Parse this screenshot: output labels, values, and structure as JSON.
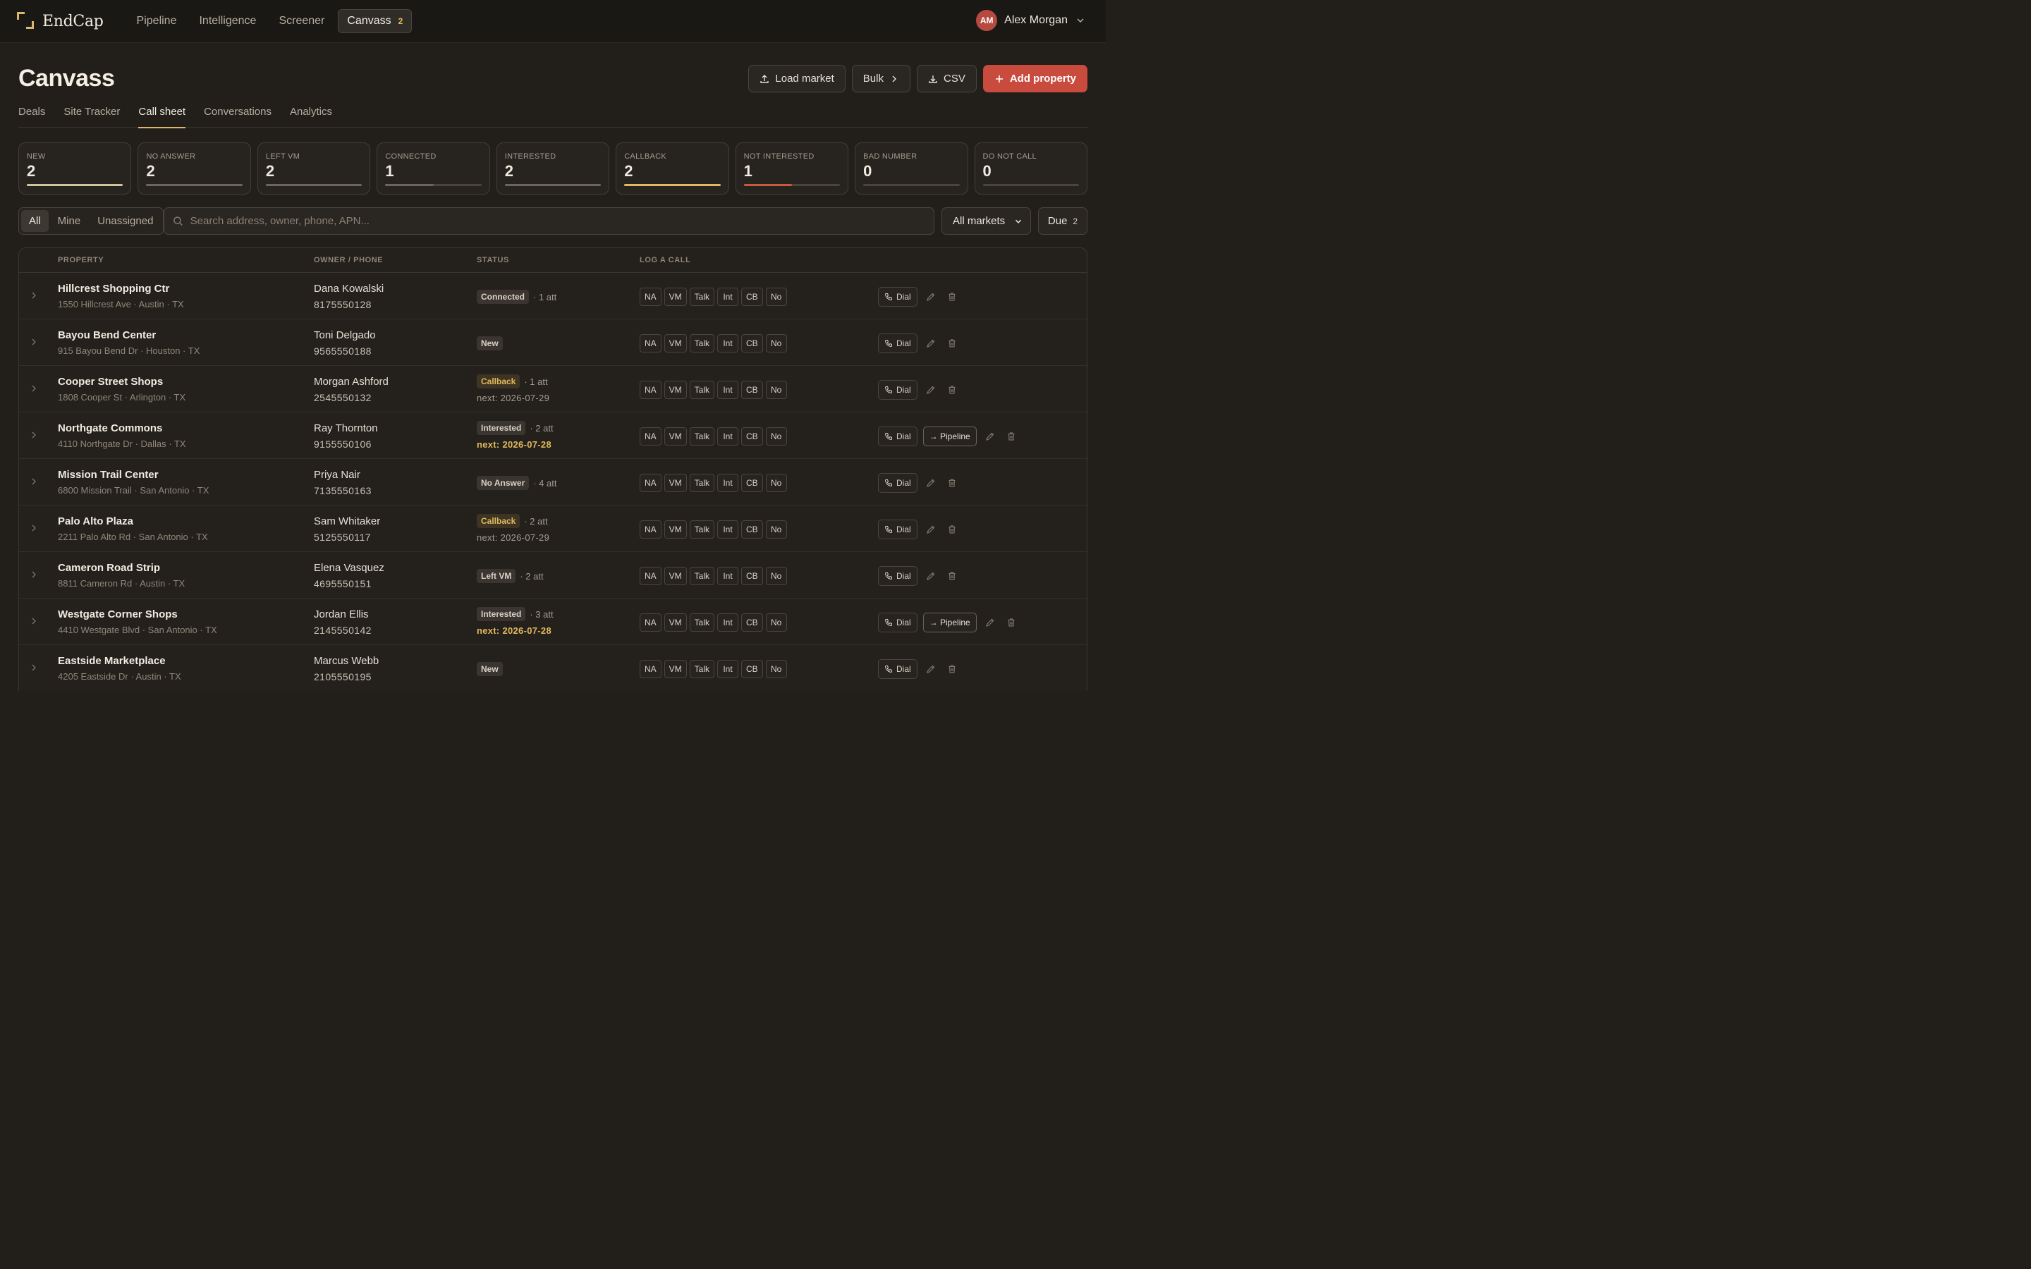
{
  "app": {
    "name": "EndCap"
  },
  "nav": {
    "links": [
      {
        "label": "Pipeline"
      },
      {
        "label": "Intelligence"
      },
      {
        "label": "Screener"
      },
      {
        "label": "Canvass",
        "badge": "2"
      }
    ]
  },
  "user": {
    "initials": "AM",
    "name": "Alex Morgan"
  },
  "page": {
    "title": "Canvass",
    "actions": {
      "load_market": "Load market",
      "bulk": "Bulk",
      "csv": "CSV",
      "add_property": "Add property"
    },
    "tabs": [
      "Deals",
      "Site Tracker",
      "Call sheet",
      "Conversations",
      "Analytics"
    ],
    "active_tab": "Call sheet"
  },
  "stats": [
    {
      "label": "NEW",
      "value": "2",
      "fill": 1.0,
      "color": "#cfc39e"
    },
    {
      "label": "NO ANSWER",
      "value": "2",
      "fill": 1.0,
      "color": "#6b655c"
    },
    {
      "label": "LEFT VM",
      "value": "2",
      "fill": 1.0,
      "color": "#6b655c"
    },
    {
      "label": "CONNECTED",
      "value": "1",
      "fill": 0.5,
      "color": "#6b655c"
    },
    {
      "label": "INTERESTED",
      "value": "2",
      "fill": 1.0,
      "color": "#6b655c"
    },
    {
      "label": "CALLBACK",
      "value": "2",
      "fill": 1.0,
      "color": "#e0b95e"
    },
    {
      "label": "NOT INTERESTED",
      "value": "1",
      "fill": 0.5,
      "color": "#c9583f"
    },
    {
      "label": "BAD NUMBER",
      "value": "0",
      "fill": 0,
      "color": "#6b655c"
    },
    {
      "label": "DO NOT CALL",
      "value": "0",
      "fill": 0,
      "color": "#6b655c"
    }
  ],
  "filters": {
    "scope": [
      "All",
      "Mine",
      "Unassigned"
    ],
    "active_scope": "All",
    "search_placeholder": "Search address, owner, phone, APN...",
    "market": "All markets",
    "due_label": "Due",
    "due_count": "2"
  },
  "table": {
    "headers": {
      "property": "PROPERTY",
      "owner": "OWNER / PHONE",
      "status": "STATUS",
      "log": "LOG A CALL"
    },
    "log_buttons": [
      "NA",
      "VM",
      "Talk",
      "Int",
      "CB",
      "No"
    ],
    "dial_label": "Dial",
    "pipeline_label": "→ Pipeline",
    "rows": [
      {
        "name": "Hillcrest Shopping Ctr",
        "address": "1550 Hillcrest Ave · Austin · TX",
        "owner": "Dana Kowalski",
        "phone": "8175550128",
        "status": "Connected",
        "attempts": "· 1 att",
        "next": "",
        "next_hot": false,
        "pipeline": false
      },
      {
        "name": "Bayou Bend Center",
        "address": "915 Bayou Bend Dr · Houston · TX",
        "owner": "Toni Delgado",
        "phone": "9565550188",
        "status": "New",
        "attempts": "",
        "next": "",
        "next_hot": false,
        "pipeline": false
      },
      {
        "name": "Cooper Street Shops",
        "address": "1808 Cooper St · Arlington · TX",
        "owner": "Morgan Ashford",
        "phone": "2545550132",
        "status": "Callback",
        "attempts": "· 1 att",
        "next": "next: 2026-07-29",
        "next_hot": false,
        "pipeline": false
      },
      {
        "name": "Northgate Commons",
        "address": "4110 Northgate Dr · Dallas · TX",
        "owner": "Ray Thornton",
        "phone": "9155550106",
        "status": "Interested",
        "attempts": "· 2 att",
        "next": "next: 2026-07-28",
        "next_hot": true,
        "pipeline": true
      },
      {
        "name": "Mission Trail Center",
        "address": "6800 Mission Trail · San Antonio · TX",
        "owner": "Priya Nair",
        "phone": "7135550163",
        "status": "No Answer",
        "attempts": "· 4 att",
        "next": "",
        "next_hot": false,
        "pipeline": false
      },
      {
        "name": "Palo Alto Plaza",
        "address": "2211 Palo Alto Rd · San Antonio · TX",
        "owner": "Sam Whitaker",
        "phone": "5125550117",
        "status": "Callback",
        "attempts": "· 2 att",
        "next": "next: 2026-07-29",
        "next_hot": false,
        "pipeline": false
      },
      {
        "name": "Cameron Road Strip",
        "address": "8811 Cameron Rd · Austin · TX",
        "owner": "Elena Vasquez",
        "phone": "4695550151",
        "status": "Left VM",
        "attempts": "· 2 att",
        "next": "",
        "next_hot": false,
        "pipeline": false
      },
      {
        "name": "Westgate Corner Shops",
        "address": "4410 Westgate Blvd · San Antonio · TX",
        "owner": "Jordan Ellis",
        "phone": "2145550142",
        "status": "Interested",
        "attempts": "· 3 att",
        "next": "next: 2026-07-28",
        "next_hot": true,
        "pipeline": true
      },
      {
        "name": "Eastside Marketplace",
        "address": "4205 Eastside Dr · Austin · TX",
        "owner": "Marcus Webb",
        "phone": "2105550195",
        "status": "New",
        "attempts": "",
        "next": "",
        "next_hot": false,
        "pipeline": false
      }
    ]
  }
}
